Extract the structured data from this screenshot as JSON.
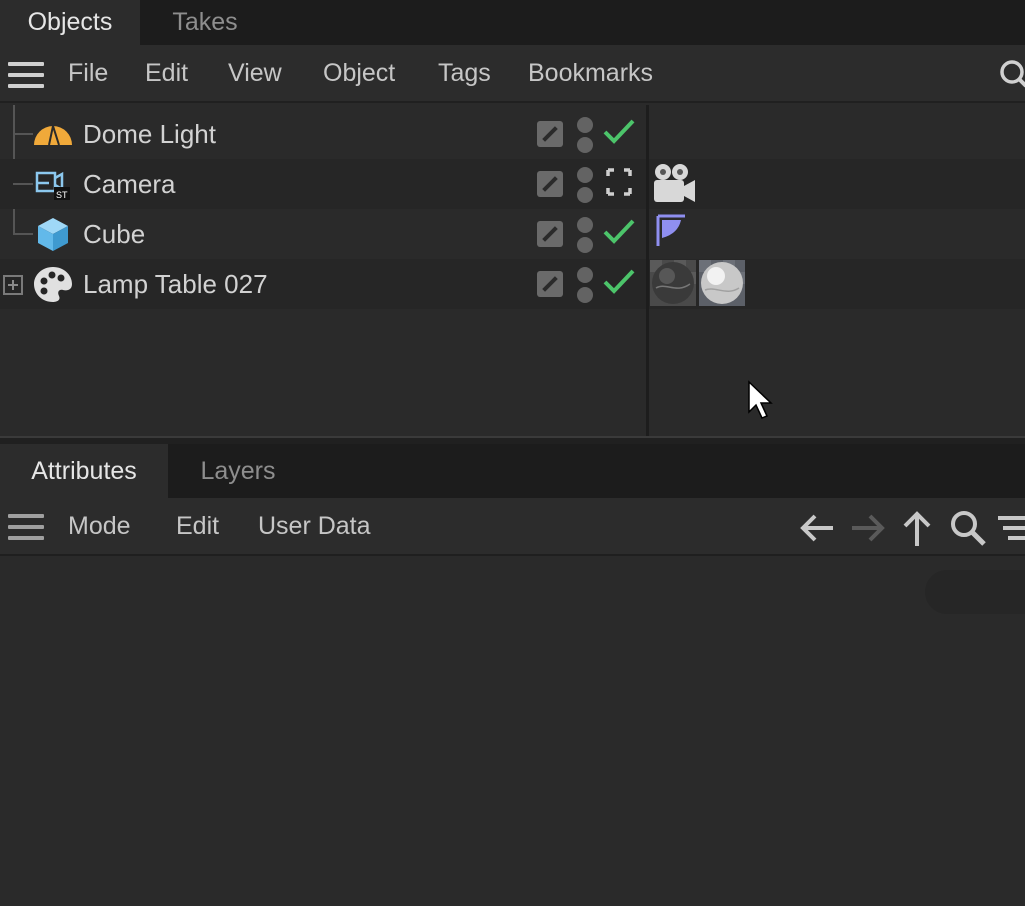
{
  "objects_panel": {
    "tabs": [
      {
        "label": "Objects",
        "active": true
      },
      {
        "label": "Takes",
        "active": false
      }
    ],
    "menu": [
      "File",
      "Edit",
      "View",
      "Object",
      "Tags",
      "Bookmarks"
    ],
    "search_icon": "search-icon",
    "objects": [
      {
        "name": "Dome Light",
        "icon": "dome-light-icon",
        "render_state": "enabled-check",
        "tags": []
      },
      {
        "name": "Camera",
        "icon": "camera-stereo-icon",
        "render_state": "focus-frame",
        "tags": [
          "camera-tag"
        ]
      },
      {
        "name": "Cube",
        "icon": "cube-icon",
        "render_state": "enabled-check",
        "tags": [
          "texture-projection-tag"
        ]
      },
      {
        "name": "Lamp Table 027",
        "icon": "material-palette-icon",
        "render_state": "enabled-check",
        "expandable": true,
        "tags": [
          "dark-marble-material-tag",
          "white-marble-material-tag"
        ]
      }
    ]
  },
  "attributes_panel": {
    "tabs": [
      {
        "label": "Attributes",
        "active": true
      },
      {
        "label": "Layers",
        "active": false
      }
    ],
    "menu": [
      "Mode",
      "Edit",
      "User Data"
    ],
    "toolbar_icons": [
      "back-arrow-icon",
      "forward-arrow-icon",
      "up-arrow-icon",
      "search-icon",
      "filter-icon"
    ]
  },
  "colors": {
    "check_green": "#4cc46a",
    "dome_orange": "#f0a93a",
    "cube_blue": "#62b9ea",
    "tag_purple": "#8f8ff0"
  }
}
